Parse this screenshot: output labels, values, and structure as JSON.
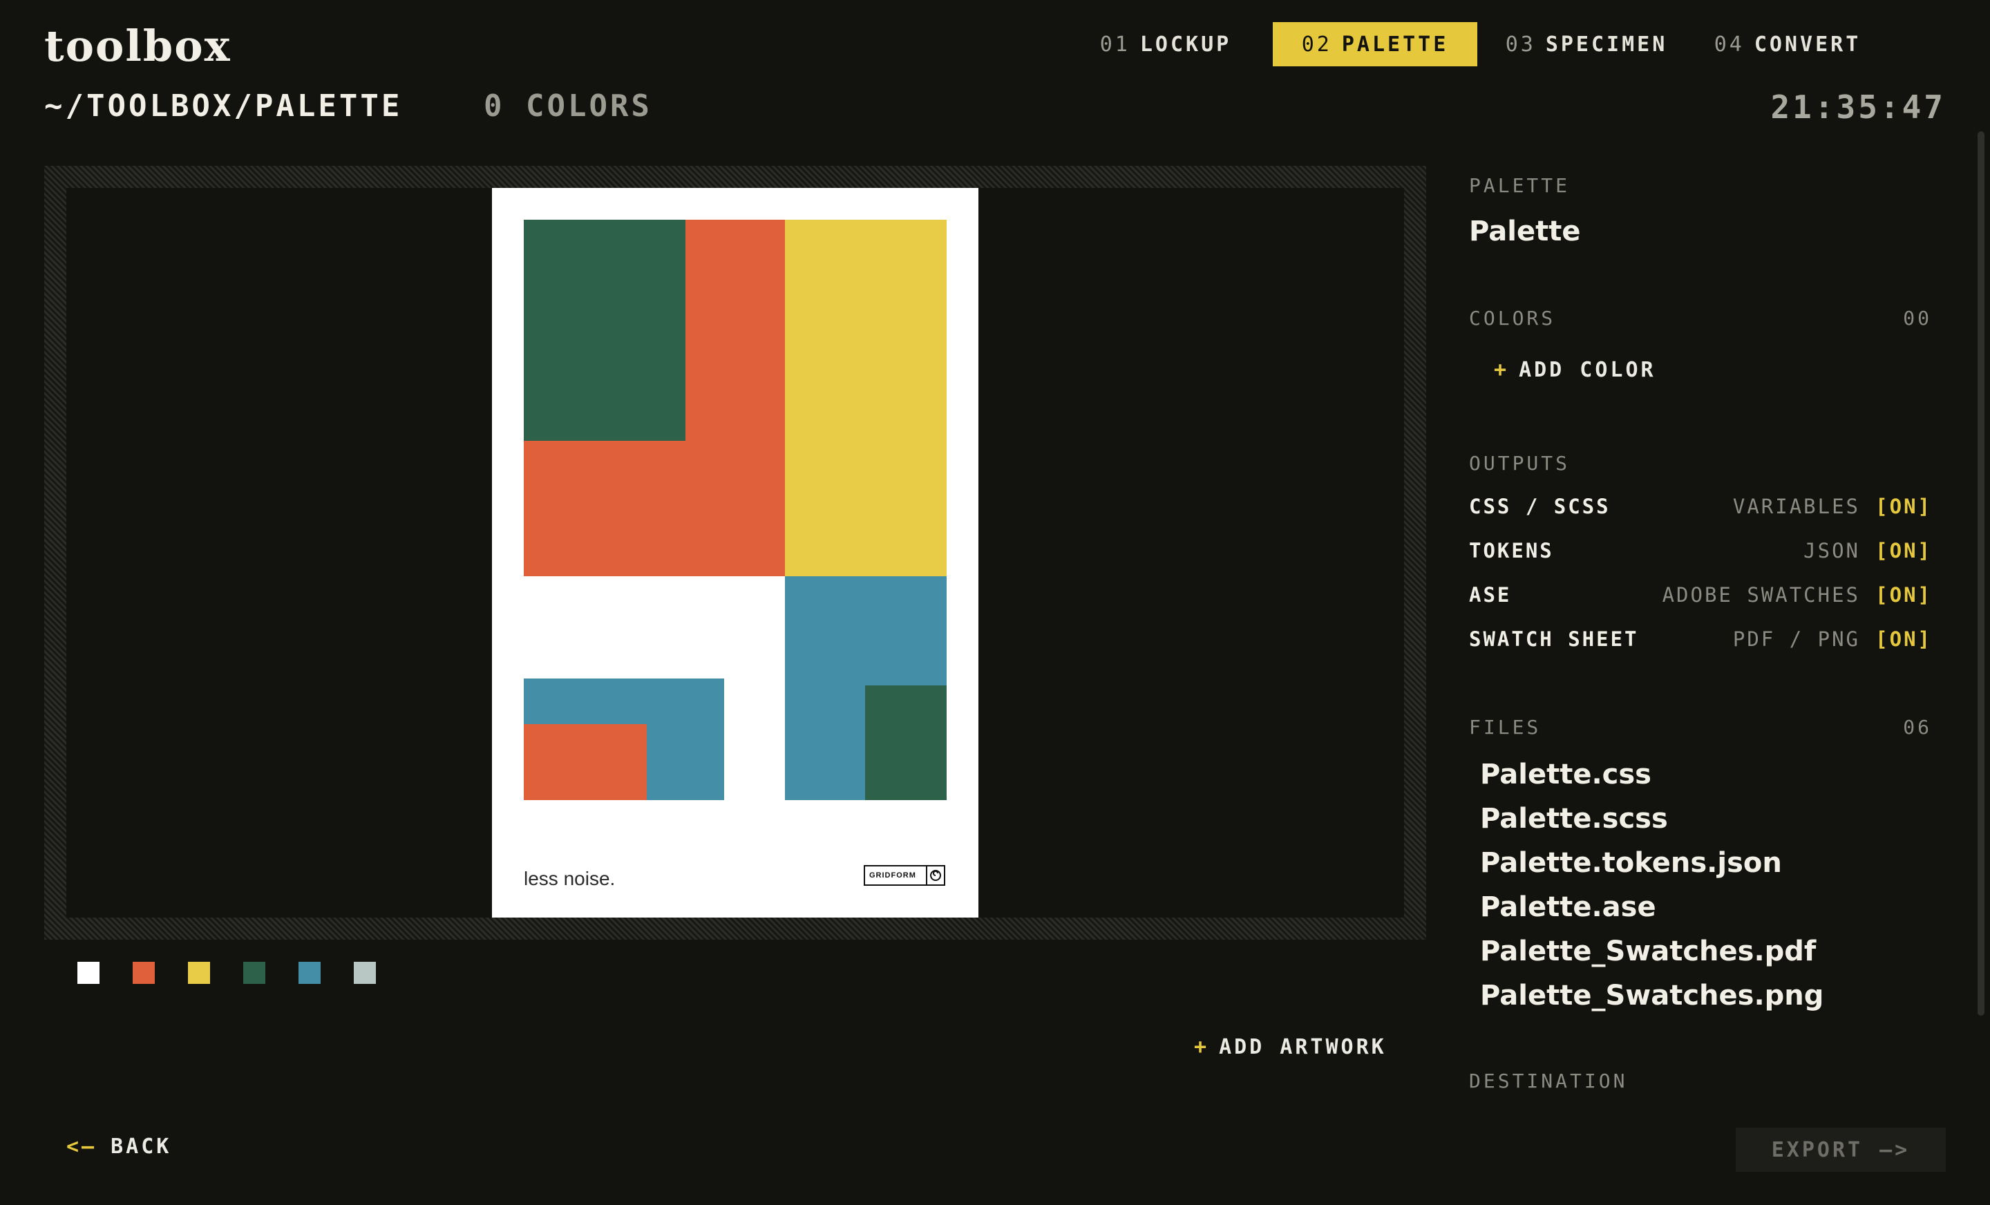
{
  "app": {
    "logo": "toolbox"
  },
  "nav": {
    "tabs": [
      {
        "num": "01",
        "label": "LOCKUP",
        "active": false
      },
      {
        "num": "02",
        "label": "PALETTE",
        "active": true
      },
      {
        "num": "03",
        "label": "SPECIMEN",
        "active": false
      },
      {
        "num": "04",
        "label": "CONVERT",
        "active": false
      }
    ]
  },
  "header": {
    "path": "~/TOOLBOX/PALETTE",
    "color_count": "0  COLORS",
    "clock": "21:35:47"
  },
  "artwork": {
    "caption": "less noise.",
    "brand_mark": "GRIDFORM",
    "colors": {
      "white": "#ffffff",
      "orange": "#e0603c",
      "yellow": "#e8cc48",
      "green": "#2e6149",
      "blue": "#448ea8"
    }
  },
  "swatches": [
    "#ffffff",
    "#e0603c",
    "#e8cc48",
    "#2e6149",
    "#448ea8",
    "#b8c6c4"
  ],
  "actions": {
    "add_artwork": "ADD ARTWORK",
    "back": "BACK",
    "export": "EXPORT"
  },
  "icons": {
    "plus": "+",
    "back_arrow": "<—",
    "export_arrow": "—>"
  },
  "panel": {
    "palette_label": "PALETTE",
    "palette_name": "Palette",
    "colors_label": "COLORS",
    "colors_count": "00",
    "add_color": "ADD COLOR",
    "outputs_label": "OUTPUTS",
    "outputs": [
      {
        "name": "CSS / SCSS",
        "format": "VARIABLES",
        "state": "[ON]"
      },
      {
        "name": "TOKENS",
        "format": "JSON",
        "state": "[ON]"
      },
      {
        "name": "ASE",
        "format": "ADOBE SWATCHES",
        "state": "[ON]"
      },
      {
        "name": "SWATCH SHEET",
        "format": "PDF / PNG",
        "state": "[ON]"
      }
    ],
    "files_label": "FILES",
    "files_count": "06",
    "files": [
      "Palette.css",
      "Palette.scss",
      "Palette.tokens.json",
      "Palette.ase",
      "Palette_Swatches.pdf",
      "Palette_Swatches.png"
    ],
    "destination_label": "DESTINATION"
  },
  "theme": {
    "accent": "#e6c83c",
    "background": "#12130f"
  }
}
